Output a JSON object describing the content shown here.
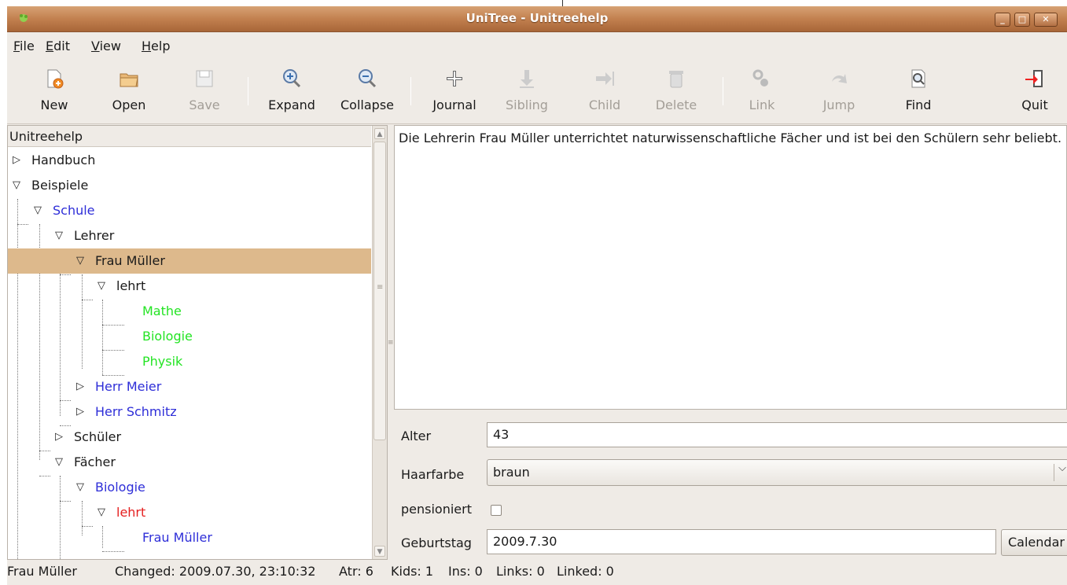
{
  "window": {
    "title": "UniTree - Unitreehelp"
  },
  "menu": [
    {
      "pre": "",
      "u": "F",
      "post": "ile"
    },
    {
      "pre": "",
      "u": "E",
      "post": "dit"
    },
    {
      "pre": "",
      "u": "V",
      "post": "iew"
    },
    {
      "pre": "",
      "u": "H",
      "post": "elp"
    }
  ],
  "toolbar": {
    "new": "New",
    "open": "Open",
    "save": "Save",
    "expand": "Expand",
    "collapse": "Collapse",
    "journal": "Journal",
    "sibling": "Sibling",
    "child": "Child",
    "delete": "Delete",
    "link": "Link",
    "jump": "Jump",
    "find": "Find",
    "quit": "Quit"
  },
  "tree": {
    "header": "Unitreehelp",
    "rows": [
      {
        "label": "Handbuch",
        "expander": "▷",
        "color": "#1a1a1a"
      },
      {
        "label": "Beispiele",
        "expander": "▽",
        "color": "#1a1a1a"
      },
      {
        "label": "Schule",
        "expander": "▽",
        "color": "#2e2ed8"
      },
      {
        "label": "Lehrer",
        "expander": "▽",
        "color": "#1a1a1a"
      },
      {
        "label": "Frau Müller",
        "expander": "▽",
        "color": "#1a1a1a",
        "selected": true
      },
      {
        "label": "lehrt",
        "expander": "▽",
        "color": "#1a1a1a"
      },
      {
        "label": "Mathe",
        "expander": "",
        "color": "#23e423"
      },
      {
        "label": "Biologie",
        "expander": "",
        "color": "#23e423"
      },
      {
        "label": "Physik",
        "expander": "",
        "color": "#23e423"
      },
      {
        "label": "Herr Meier",
        "expander": "▷",
        "color": "#2e2ed8"
      },
      {
        "label": "Herr Schmitz",
        "expander": "▷",
        "color": "#2e2ed8"
      },
      {
        "label": "Schüler",
        "expander": "▷",
        "color": "#1a1a1a"
      },
      {
        "label": "Fächer",
        "expander": "▽",
        "color": "#1a1a1a"
      },
      {
        "label": "Biologie",
        "expander": "▽",
        "color": "#2e2ed8"
      },
      {
        "label": "lehrt",
        "expander": "▽",
        "color": "#e52020"
      },
      {
        "label": "Frau Müller",
        "expander": "",
        "color": "#2e2ed8"
      }
    ]
  },
  "content": {
    "text": "Die Lehrerin Frau Müller unterrichtet naturwissenschaftliche Fächer und ist bei den Schülern sehr beliebt."
  },
  "fields": {
    "alter_label": "Alter",
    "alter_value": "43",
    "haarfarbe_label": "Haarfarbe",
    "haarfarbe_value": "braun",
    "pensioniert_label": "pensioniert",
    "geburtstag_label": "Geburtstag",
    "geburtstag_value": "2009.7.30",
    "calendar_label": "Calendar"
  },
  "status": {
    "node": "Frau Müller",
    "changed": "Changed: 2009.07.30, 23:10:32",
    "atr": "Atr: 6",
    "kids": "Kids: 1",
    "ins": "Ins: 0",
    "links": "Links: 0",
    "linked": "Linked: 0"
  },
  "colors": {
    "selection": "#ddb98c",
    "titlebar": "#c2804f"
  }
}
